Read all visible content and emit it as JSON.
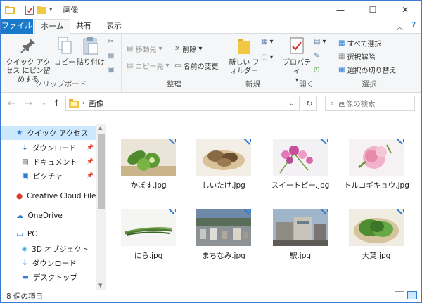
{
  "window": {
    "title": "画像"
  },
  "tabs": [
    {
      "label": "ファイル"
    },
    {
      "label": "ホーム"
    },
    {
      "label": "共有"
    },
    {
      "label": "表示"
    }
  ],
  "ribbon": {
    "clipboard": {
      "pin_label": "クイック アクセス にピン留めする",
      "copy_label": "コピー",
      "paste_label": "貼り付け",
      "group_label": "クリップボード"
    },
    "organize": {
      "move_label": "移動先",
      "copy_to_label": "コピー先",
      "delete_label": "削除",
      "rename_label": "名前の変更",
      "group_label": "整理"
    },
    "new": {
      "folder_label": "新しい フォルダー",
      "group_label": "新規"
    },
    "open": {
      "properties_label": "プロパティ",
      "group_label": "開く"
    },
    "select": {
      "select_all": "すべて選択",
      "select_none": "選択解除",
      "invert": "選択の切り替え",
      "group_label": "選択"
    }
  },
  "address": {
    "path": "画像",
    "search_placeholder": "画像の検索"
  },
  "navpane": {
    "items": [
      {
        "label": "クイック アクセス",
        "icon": "star-icon",
        "pinned": false
      },
      {
        "label": "ダウンロード",
        "icon": "download-icon",
        "pinned": true
      },
      {
        "label": "ドキュメント",
        "icon": "document-icon",
        "pinned": true
      },
      {
        "label": "ピクチャ",
        "icon": "pictures-icon",
        "pinned": true
      },
      {
        "label": "Creative Cloud Files",
        "icon": "creative-cloud-icon",
        "pinned": false
      },
      {
        "label": "OneDrive",
        "icon": "onedrive-icon",
        "pinned": false
      },
      {
        "label": "PC",
        "icon": "pc-icon",
        "pinned": false
      },
      {
        "label": "3D オブジェクト",
        "icon": "3d-objects-icon",
        "pinned": false
      },
      {
        "label": "ダウンロード",
        "icon": "download-icon",
        "pinned": false
      },
      {
        "label": "デスクトップ",
        "icon": "desktop-icon",
        "pinned": false
      }
    ]
  },
  "files": [
    {
      "name": "かぼす.jpg",
      "bg": "#e9e4da",
      "main": "#4f8a2e"
    },
    {
      "name": "しいたけ.jpg",
      "bg": "#f3efe6",
      "main": "#8a6a45"
    },
    {
      "name": "スイートピー.jpg",
      "bg": "#f4f1f4",
      "main": "#d46aa6"
    },
    {
      "name": "トルコギキョウ.jpg",
      "bg": "#f6f2f4",
      "main": "#e59ab5"
    },
    {
      "name": "にら.jpg",
      "bg": "#f5f5f3",
      "main": "#4c7a2f"
    },
    {
      "name": "まちなみ.jpg",
      "bg": "#6e8aa8",
      "main": "#7c8a7a"
    },
    {
      "name": "駅.jpg",
      "bg": "#9fb5c9",
      "main": "#8f8c86"
    },
    {
      "name": "大葉.jpg",
      "bg": "#f1ece2",
      "main": "#4e8c32"
    }
  ],
  "status": {
    "count_text": "8 個の項目"
  },
  "colors": {
    "accent": "#1979ca",
    "selection": "#cce8ff",
    "sync_badge": "#2b7cd3"
  }
}
